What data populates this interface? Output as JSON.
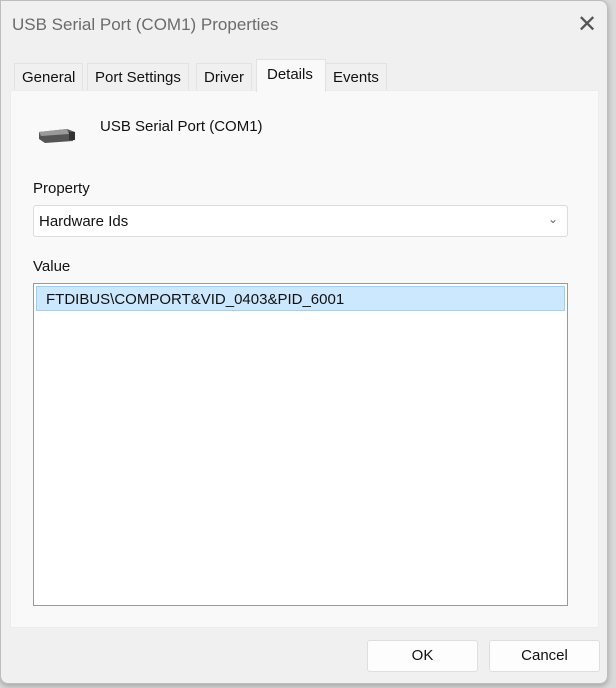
{
  "window": {
    "title": "USB Serial Port (COM1) Properties"
  },
  "tabs": [
    {
      "label": "General"
    },
    {
      "label": "Port Settings"
    },
    {
      "label": "Driver"
    },
    {
      "label": "Details"
    },
    {
      "label": "Events"
    }
  ],
  "active_tab": "Details",
  "device": {
    "name": "USB Serial Port (COM1)",
    "icon": "serial-port-icon"
  },
  "property": {
    "label": "Property",
    "selected": "Hardware Ids"
  },
  "value": {
    "label": "Value",
    "items": [
      "FTDIBUS\\COMPORT&VID_0403&PID_6001"
    ]
  },
  "buttons": {
    "ok": "OK",
    "cancel": "Cancel"
  }
}
